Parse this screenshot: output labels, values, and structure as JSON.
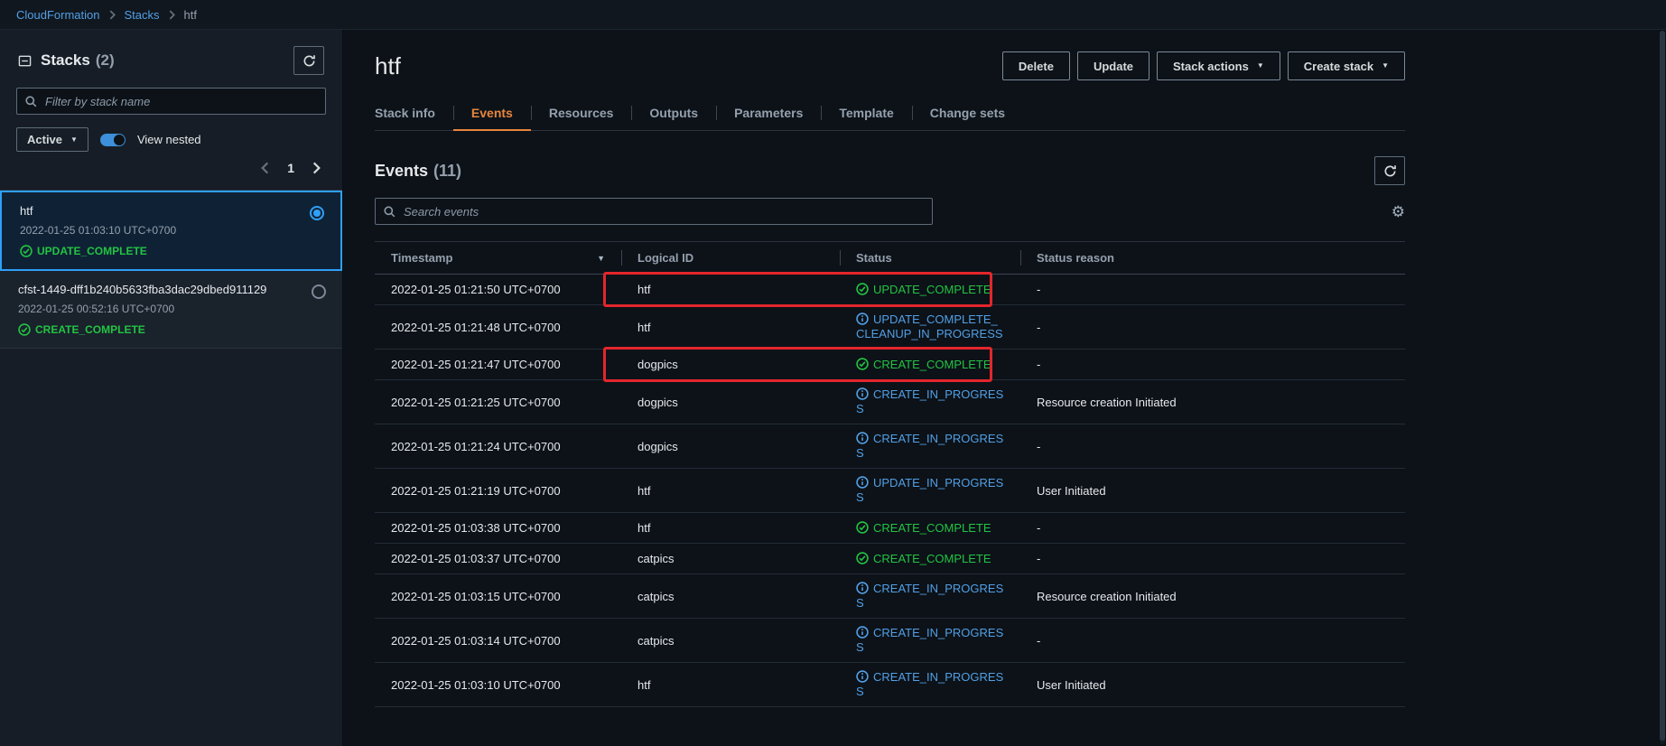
{
  "colors": {
    "link_blue": "#539fe5",
    "success_green": "#23c343",
    "info_blue": "#539fe5",
    "tab_orange": "#e8853d",
    "annotation_red": "#e3262c",
    "selected_blue": "#2ea0f8"
  },
  "breadcrumb": {
    "items": [
      "CloudFormation",
      "Stacks",
      "htf"
    ]
  },
  "sidebar": {
    "title": "Stacks",
    "count": "(2)",
    "filter_placeholder": "Filter by stack name",
    "status_filter": "Active",
    "view_nested_label": "View nested",
    "pagination": {
      "page": "1"
    },
    "stacks": [
      {
        "name": "htf",
        "timestamp": "2022-01-25 01:03:10 UTC+0700",
        "status": "UPDATE_COMPLETE",
        "selected": true
      },
      {
        "name": "cfst-1449-dff1b240b5633fba3dac29dbed911129",
        "timestamp": "2022-01-25 00:52:16 UTC+0700",
        "status": "CREATE_COMPLETE",
        "selected": false
      }
    ]
  },
  "header": {
    "title": "htf",
    "buttons": [
      {
        "id": "delete",
        "label": "Delete",
        "caret": false
      },
      {
        "id": "update",
        "label": "Update",
        "caret": false
      },
      {
        "id": "stack-actions",
        "label": "Stack actions",
        "caret": true
      },
      {
        "id": "create-stack",
        "label": "Create stack",
        "caret": true
      }
    ]
  },
  "active_tab": "events",
  "tabs": [
    {
      "id": "stack-info",
      "label": "Stack info"
    },
    {
      "id": "events",
      "label": "Events"
    },
    {
      "id": "resources",
      "label": "Resources"
    },
    {
      "id": "outputs",
      "label": "Outputs"
    },
    {
      "id": "parameters",
      "label": "Parameters"
    },
    {
      "id": "template",
      "label": "Template"
    },
    {
      "id": "change-sets",
      "label": "Change sets"
    }
  ],
  "events": {
    "heading": "Events",
    "count": "(11)",
    "search_placeholder": "Search events",
    "table": {
      "columns": [
        "Timestamp",
        "Logical ID",
        "Status",
        "Status reason"
      ],
      "rows": [
        {
          "timestamp": "2022-01-25 01:21:50 UTC+0700",
          "logical_id": "htf",
          "status": "UPDATE_COMPLETE",
          "status_type": "success",
          "reason": "-",
          "annotated": true
        },
        {
          "timestamp": "2022-01-25 01:21:48 UTC+0700",
          "logical_id": "htf",
          "status": "UPDATE_COMPLETE_CLEANUP_IN_PROGRESS",
          "status_type": "info",
          "reason": "-",
          "annotated": false
        },
        {
          "timestamp": "2022-01-25 01:21:47 UTC+0700",
          "logical_id": "dogpics",
          "status": "CREATE_COMPLETE",
          "status_type": "success",
          "reason": "-",
          "annotated": true
        },
        {
          "timestamp": "2022-01-25 01:21:25 UTC+0700",
          "logical_id": "dogpics",
          "status": "CREATE_IN_PROGRESS",
          "status_type": "info",
          "reason": "Resource creation Initiated",
          "annotated": false
        },
        {
          "timestamp": "2022-01-25 01:21:24 UTC+0700",
          "logical_id": "dogpics",
          "status": "CREATE_IN_PROGRESS",
          "status_type": "info",
          "reason": "-",
          "annotated": false
        },
        {
          "timestamp": "2022-01-25 01:21:19 UTC+0700",
          "logical_id": "htf",
          "status": "UPDATE_IN_PROGRESS",
          "status_type": "info",
          "reason": "User Initiated",
          "annotated": false
        },
        {
          "timestamp": "2022-01-25 01:03:38 UTC+0700",
          "logical_id": "htf",
          "status": "CREATE_COMPLETE",
          "status_type": "success",
          "reason": "-",
          "annotated": false
        },
        {
          "timestamp": "2022-01-25 01:03:37 UTC+0700",
          "logical_id": "catpics",
          "status": "CREATE_COMPLETE",
          "status_type": "success",
          "reason": "-",
          "annotated": false
        },
        {
          "timestamp": "2022-01-25 01:03:15 UTC+0700",
          "logical_id": "catpics",
          "status": "CREATE_IN_PROGRESS",
          "status_type": "info",
          "reason": "Resource creation Initiated",
          "annotated": false
        },
        {
          "timestamp": "2022-01-25 01:03:14 UTC+0700",
          "logical_id": "catpics",
          "status": "CREATE_IN_PROGRESS",
          "status_type": "info",
          "reason": "-",
          "annotated": false
        },
        {
          "timestamp": "2022-01-25 01:03:10 UTC+0700",
          "logical_id": "htf",
          "status": "CREATE_IN_PROGRESS",
          "status_type": "info",
          "reason": "User Initiated",
          "annotated": false
        }
      ]
    }
  }
}
